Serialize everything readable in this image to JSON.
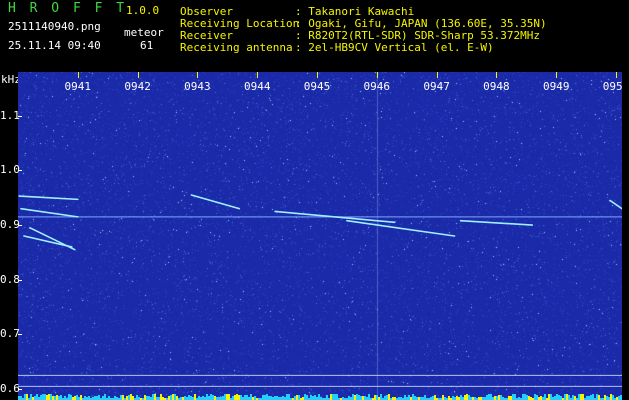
{
  "app": {
    "name": "H R O F F T",
    "version": "1.0.0",
    "filename": "2511140940.png",
    "datetime": "25.11.14 09:40",
    "meteor_label": "meteor",
    "meteor_count": "61"
  },
  "info": {
    "rows": [
      {
        "label": "Observer",
        "value": ": Takanori Kawachi"
      },
      {
        "label": "Receiving Location",
        "value": ": Ogaki, Gifu, JAPAN (136.60E, 35.35N)"
      },
      {
        "label": "Receiver",
        "value": ": R820T2(RTL-SDR) SDR-Sharp 53.372MHz"
      },
      {
        "label": "Receiving antenna",
        "value": ": 2el-HB9CV Vertical (el. E-W)"
      }
    ]
  },
  "colors": {
    "background": "#1b2aa8",
    "accent_yellow": "#f5f500",
    "accent_green": "#3fd83f",
    "baseline_cyan": "#20d0ff"
  },
  "chart_data": {
    "type": "heatmap",
    "ylabel": "kHz",
    "yticks": [
      "1.1",
      "1.0",
      "0.9",
      "0.8",
      "0.7",
      "0.6"
    ],
    "y_ticks_values": [
      1.1,
      1.0,
      0.9,
      0.8,
      0.7,
      0.6
    ],
    "ylim": [
      0.58,
      1.18
    ],
    "xticks": [
      "0941",
      "0942",
      "0943",
      "0944",
      "0945",
      "0946",
      "0947",
      "0948",
      "0949",
      "0950"
    ],
    "x_minutes": [
      41,
      42,
      43,
      44,
      45,
      46,
      47,
      48,
      49,
      50
    ],
    "xlim_minutes": [
      40.0,
      50.1
    ],
    "carrier_khz": 0.915,
    "reference_lines_khz": [
      0.625,
      0.605
    ],
    "echoes": [
      {
        "t0": 40.02,
        "f0": 0.953,
        "t1": 41.0,
        "f1": 0.947
      },
      {
        "t0": 40.05,
        "f0": 0.93,
        "t1": 41.0,
        "f1": 0.915
      },
      {
        "t0": 40.2,
        "f0": 0.895,
        "t1": 40.95,
        "f1": 0.855
      },
      {
        "t0": 40.1,
        "f0": 0.88,
        "t1": 40.9,
        "f1": 0.86
      },
      {
        "t0": 42.9,
        "f0": 0.955,
        "t1": 43.7,
        "f1": 0.93
      },
      {
        "t0": 44.3,
        "f0": 0.925,
        "t1": 46.3,
        "f1": 0.905
      },
      {
        "t0": 45.5,
        "f0": 0.908,
        "t1": 47.3,
        "f1": 0.88
      },
      {
        "t0": 47.4,
        "f0": 0.908,
        "t1": 48.6,
        "f1": 0.9
      },
      {
        "t0": 49.9,
        "f0": 0.945,
        "t1": 50.1,
        "f1": 0.93
      }
    ]
  }
}
